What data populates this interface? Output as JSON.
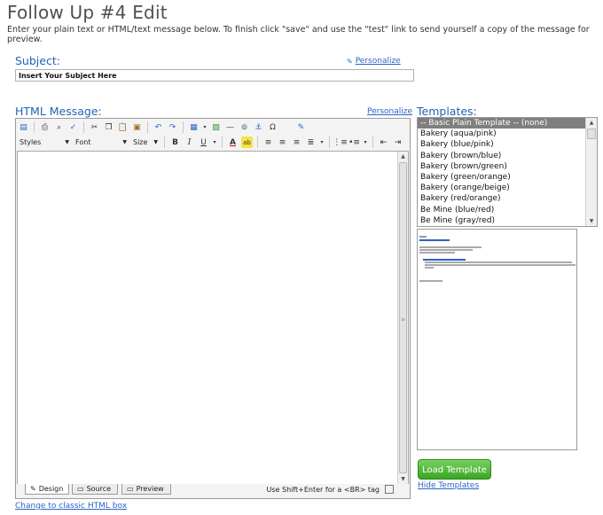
{
  "page": {
    "title": "Follow Up #4 Edit",
    "intro": "Enter your plain text or HTML/text message below. To finish click \"save\" and use the \"test\" link to send yourself a copy of the message for preview."
  },
  "subject": {
    "label": "Subject:",
    "value": "Insert Your Subject Here",
    "personalize_label": "Personalize"
  },
  "html_message": {
    "label": "HTML Message:",
    "personalize_label": "Personalize",
    "toolbar": {
      "styles_label": "Styles",
      "font_label": "Font",
      "size_label": "Size",
      "bold": "B",
      "italic": "I",
      "underline": "U",
      "font_color": "A",
      "special_char": "Ω"
    },
    "tabs": [
      {
        "label": "Design",
        "icon": "pencil-icon"
      },
      {
        "label": "Source",
        "icon": "code-icon"
      },
      {
        "label": "Preview",
        "icon": "preview-icon"
      }
    ],
    "shift_hint": "Use Shift+Enter for a <BR> tag",
    "classic_link": "Change to classic HTML box"
  },
  "templates": {
    "label": "Templates:",
    "items": [
      "-- Basic Plain Template -- (none)",
      "Bakery (aqua/pink)",
      "Bakery (blue/pink)",
      "Bakery (brown/blue)",
      "Bakery (brown/green)",
      "Bakery (green/orange)",
      "Bakery (orange/beige)",
      "Bakery (red/orange)",
      "Be Mine (blue/red)",
      "Be Mine (gray/red)"
    ],
    "selected_index": 0,
    "load_button": "Load Template",
    "hide_link": "Hide Templates"
  },
  "colors": {
    "title": "#4f4f4f",
    "label_blue": "#1e64b4",
    "link_blue": "#2a63c6",
    "button_green": "#3aa524",
    "selected_gray": "#7f7f7f"
  }
}
